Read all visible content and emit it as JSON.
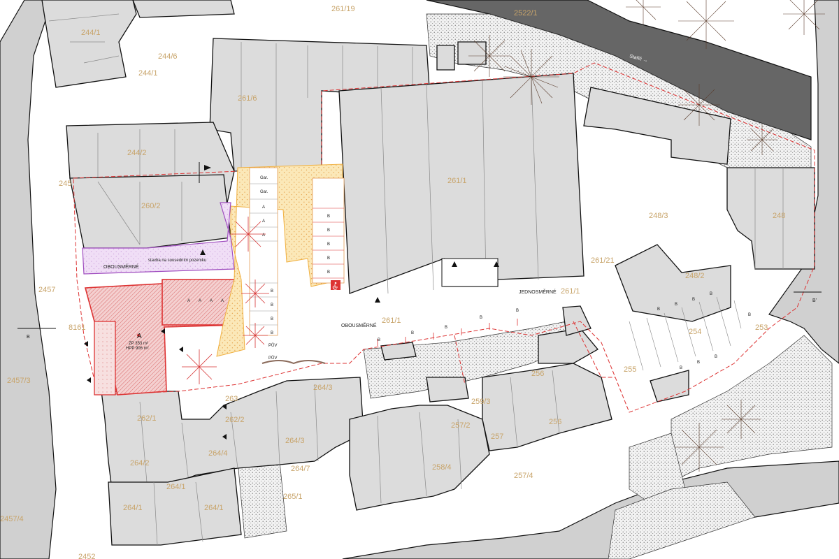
{
  "map": {
    "river_label": "Stařič →",
    "parcels": {
      "p261_19": "261/19",
      "p2522_1": "2522/1",
      "p244_1a": "244/1",
      "p244_1b": "244/1",
      "p244_6": "244/6",
      "p261_6": "261/6",
      "p244_2": "244/2",
      "p245": "245",
      "p260_2": "260/2",
      "p261_1": "261/1",
      "p261_1b": "261/1",
      "p261_1c": "261/1",
      "p248_3": "248/3",
      "p248_2": "248/2",
      "p261_21": "261/21",
      "p254": "254",
      "p255": "255",
      "p256": "256",
      "p256b": "256",
      "p257_2": "257/2",
      "p257_4": "257/4",
      "p257": "257",
      "p258_4": "258/4",
      "p259_3": "259/3",
      "p2457_3": "2457/3",
      "p2457_4": "2457/4",
      "p2457": "2457",
      "p8161": "8161",
      "p262_1": "262/1",
      "p262_2": "262/2",
      "p263": "263",
      "p264_3a": "264/3",
      "p264_3b": "264/3",
      "p264_4": "264/4",
      "p264_7": "264/7",
      "p264_2": "264/2",
      "p264_1a": "264/1",
      "p264_1b": "264/1",
      "p264_1c": "264/1",
      "p265_1": "265/1",
      "p248": "248",
      "p253": "253",
      "p2452": "2452"
    },
    "building_a": {
      "letter": "A",
      "zp": "ZP 353 m²",
      "hpp": "HPP 906 m²"
    },
    "labels": {
      "oboustranne_left": "OBOUSMĚRNÉ",
      "oboustranne_mid": "OBOUSMĚRNÉ",
      "jednosmerne": "JEDNOSMĚRNÉ",
      "stavba": "stavba na sousedním pozemku",
      "b_marker": "B",
      "b_prime_marker": "B'",
      "a_marker": "A",
      "gar1": "Gar.",
      "gar2": "Gar.",
      "puv1": "PŮV",
      "puv2": "PŮV",
      "parking_letters": {
        "a": "A",
        "b": "B"
      }
    }
  },
  "colors": {
    "building": "#dcdcdc",
    "road": "#d0d0d0",
    "river": "#666666",
    "parcel_text": "#c8a46a",
    "boundary_red": "#dd3333",
    "proposal_orange": "#f0b040",
    "purple": "#a04fc0"
  },
  "icons": [
    "tree-icon",
    "north-arrow-icon",
    "wheelchair-icon",
    "section-arrow-icon"
  ]
}
